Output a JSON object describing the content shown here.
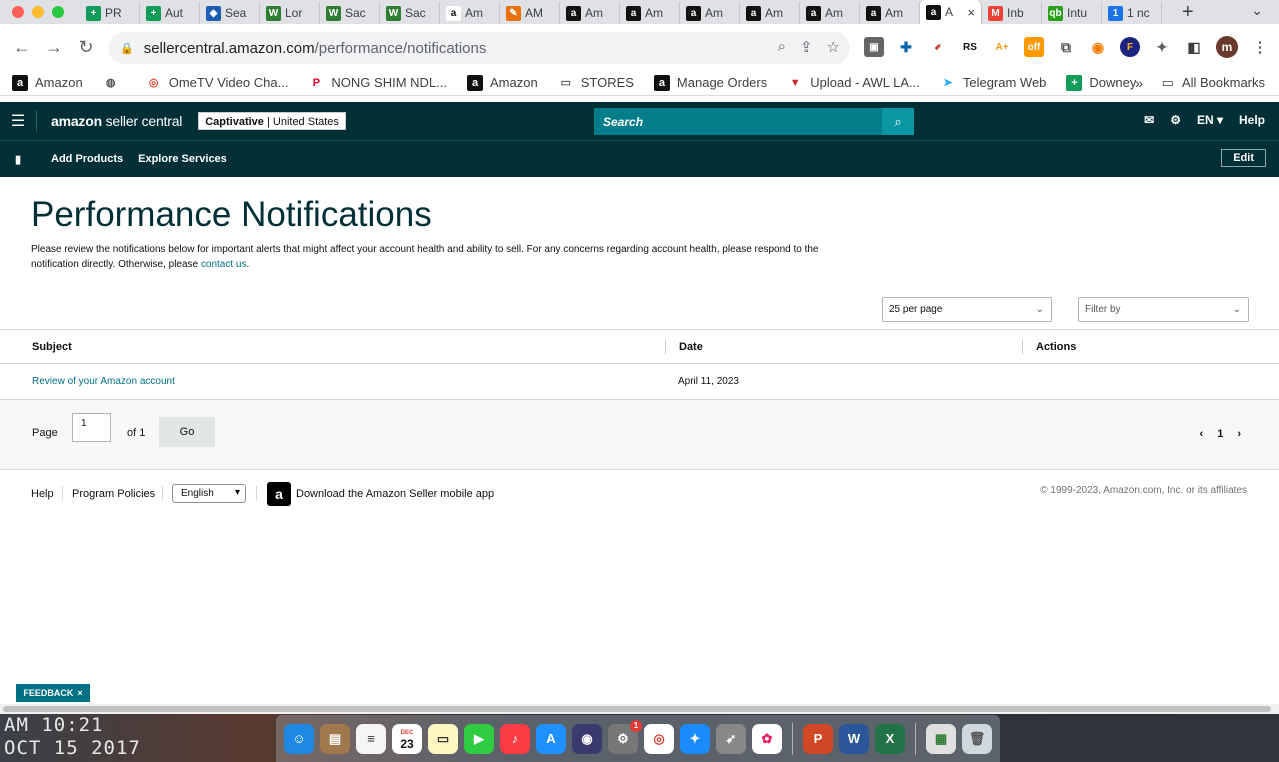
{
  "browser": {
    "tabs": [
      {
        "label": "PR",
        "icon": "sheets-icon",
        "color": "#0f9d58",
        "glyph": "+"
      },
      {
        "label": "Aut",
        "icon": "sheets-icon",
        "color": "#0f9d58",
        "glyph": "+"
      },
      {
        "label": "Sea",
        "icon": "diamond-icon",
        "color": "#1a5fb4",
        "glyph": "◆"
      },
      {
        "label": "Lor",
        "icon": "wave-icon",
        "color": "#2e7d32",
        "glyph": "W"
      },
      {
        "label": "Sac",
        "icon": "wave-icon",
        "color": "#2e7d32",
        "glyph": "W"
      },
      {
        "label": "Sac",
        "icon": "wave-icon",
        "color": "#2e7d32",
        "glyph": "W"
      },
      {
        "label": "Am",
        "icon": "amazon-smile-icon",
        "color": "#ffffff",
        "glyph": "a"
      },
      {
        "label": "AM",
        "icon": "pen-icon",
        "color": "#e8710a",
        "glyph": "✎"
      },
      {
        "label": "Am",
        "icon": "amazon-icon",
        "color": "#111111",
        "glyph": "a"
      },
      {
        "label": "Am",
        "icon": "amazon-icon",
        "color": "#111111",
        "glyph": "a"
      },
      {
        "label": "Am",
        "icon": "amazon-icon",
        "color": "#111111",
        "glyph": "a"
      },
      {
        "label": "Am",
        "icon": "amazon-icon",
        "color": "#111111",
        "glyph": "a"
      },
      {
        "label": "Am",
        "icon": "amazon-icon",
        "color": "#111111",
        "glyph": "a"
      },
      {
        "label": "Am",
        "icon": "amazon-icon",
        "color": "#111111",
        "glyph": "a"
      },
      {
        "label": "A",
        "icon": "amazon-icon",
        "color": "#111111",
        "glyph": "a",
        "active": true
      },
      {
        "label": "Inb",
        "icon": "gmail-icon",
        "color": "#ea4335",
        "glyph": "M"
      },
      {
        "label": "Intu",
        "icon": "quickbooks-icon",
        "color": "#2ca01c",
        "glyph": "qb"
      },
      {
        "label": "1 nc",
        "icon": "number-icon",
        "color": "#1a73e8",
        "glyph": "1"
      }
    ],
    "url_host": "sellercentral.amazon.com",
    "url_path": "/performance/notifications",
    "profile_initial": "m",
    "bookmarks": [
      {
        "label": "Amazon",
        "icon": "amazon-icon",
        "color": "#111111",
        "glyph": "a"
      },
      {
        "label": "",
        "icon": "globe-icon",
        "color": "#555555",
        "glyph": "◍"
      },
      {
        "label": "OmeTV Video Cha...",
        "icon": "ometv-icon",
        "color": "#e74c3c",
        "glyph": "◎"
      },
      {
        "label": "NONG SHIM NDL...",
        "icon": "pinterest-icon",
        "color": "#e60023",
        "glyph": "P"
      },
      {
        "label": "Amazon",
        "icon": "amazon-icon",
        "color": "#111111",
        "glyph": "a"
      },
      {
        "label": "STORES",
        "icon": "folder-icon",
        "color": "#5f6368",
        "glyph": "▭"
      },
      {
        "label": "Manage Orders",
        "icon": "amazon-icon",
        "color": "#111111",
        "glyph": "a"
      },
      {
        "label": "Upload - AWL LA...",
        "icon": "triangle-logo-icon",
        "color": "#c62828",
        "glyph": "▼"
      },
      {
        "label": "Telegram Web",
        "icon": "telegram-icon",
        "color": "#2aabee",
        "glyph": "➤"
      },
      {
        "label": "Downey",
        "icon": "sheets-icon",
        "color": "#0f9d58",
        "glyph": "+"
      }
    ],
    "bookmarks_overflow": "»",
    "all_bookmarks": "All Bookmarks"
  },
  "header": {
    "logo_bold": "amazon",
    "logo_light": " seller central",
    "account_name": "Captivative",
    "account_region": " | United States",
    "search_placeholder": "Search",
    "language": "EN",
    "help": "Help",
    "nav_links": [
      "Add Products",
      "Explore Services"
    ],
    "edit": "Edit"
  },
  "page": {
    "title": "Performance Notifications",
    "description": "Please review the notifications below for important alerts that might affect your account health and ability to sell. For any concerns regarding account health, please respond to the notification directly. Otherwise, please ",
    "contact_link": "contact us",
    "description_end": ".",
    "per_page": "25 per page",
    "filter_placeholder": "Filter by"
  },
  "table": {
    "columns": [
      "Subject",
      "Date",
      "Actions"
    ],
    "rows": [
      {
        "subject": "Review of your Amazon account",
        "date": "April 11, 2023",
        "actions": ""
      }
    ]
  },
  "pagination": {
    "page_label": "Page",
    "page_value": "1",
    "of_label": "of 1",
    "go": "Go",
    "current": "1"
  },
  "footer": {
    "help": "Help",
    "policies": "Program Policies",
    "language": "English",
    "app": "Download the Amazon Seller mobile app",
    "copyright": "© 1999-2023, Amazon.com, Inc. or its affiliates"
  },
  "feedback": "FEEDBACK",
  "desktop": {
    "clock_time": "AM 10:21",
    "clock_date": "OCT 15 2017",
    "calendar_day": "23",
    "calendar_month": "DEC",
    "notification_badge": "1"
  }
}
